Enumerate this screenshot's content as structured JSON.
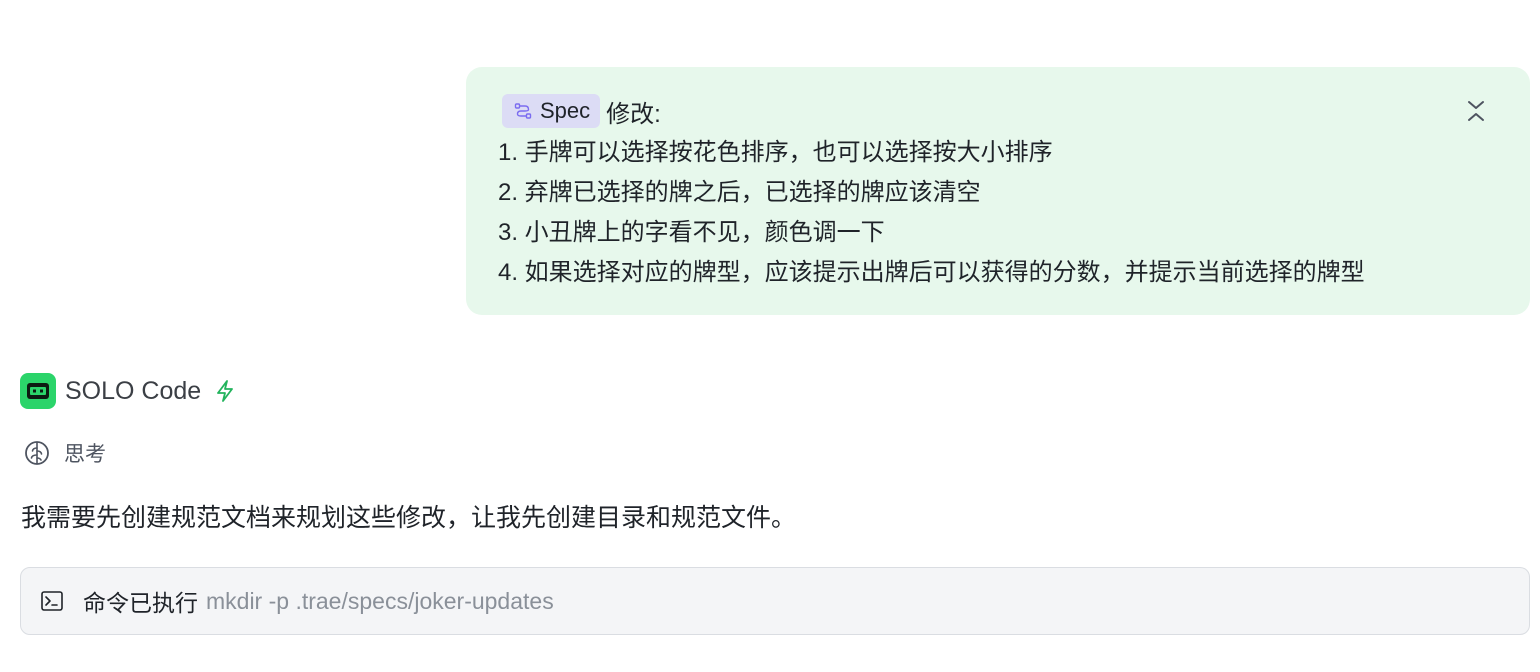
{
  "user_message": {
    "spec_chip_label": "Spec",
    "spec_suffix": "修改:",
    "items": [
      "1. 手牌可以选择按花色排序，也可以选择按大小排序",
      "2. 弃牌已选择的牌之后，已选择的牌应该清空",
      "3. 小丑牌上的字看不见，颜色调一下",
      "4. 如果选择对应的牌型，应该提示出牌后可以获得的分数，并提示当前选择的牌型"
    ],
    "collapse_icon": "collapse-icon",
    "bubble_color": "#e7f8ec"
  },
  "assistant": {
    "name": "SOLO Code",
    "avatar_color": "#2bd46a",
    "bolt_icon": "bolt-icon",
    "thinking_label": "思考",
    "message": "我需要先创建规范文档来规划这些修改，让我先创建目录和规范文件。"
  },
  "command": {
    "status": "命令已执行",
    "text": "mkdir -p .trae/specs/joker-updates",
    "icon": "terminal-icon"
  }
}
